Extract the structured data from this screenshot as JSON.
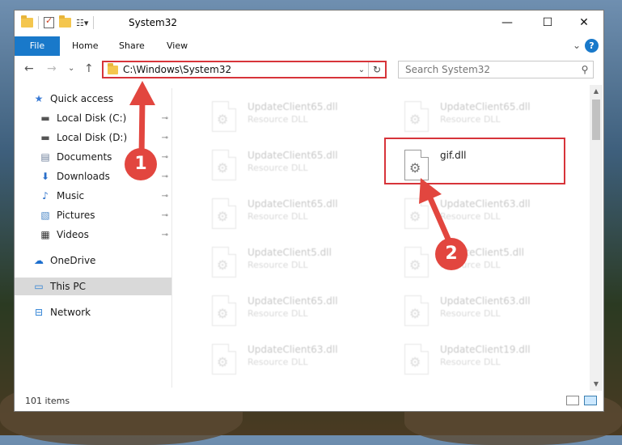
{
  "window": {
    "title": "System32",
    "controls": {
      "minimize": "—",
      "maximize": "☐",
      "close": "✕"
    }
  },
  "ribbon": {
    "tabs": [
      "File",
      "Home",
      "Share",
      "View"
    ],
    "collapse_glyph": "⌄",
    "help_label": "?"
  },
  "nav": {
    "back": "←",
    "forward": "→",
    "recent": "⌄",
    "up": "↑",
    "address": "C:\\Windows\\System32",
    "refresh": "↻",
    "search_placeholder": "Search System32"
  },
  "sidebar": {
    "items": [
      {
        "label": "Quick access",
        "icon": "star-icon",
        "glyph": "★",
        "color": "#3a7bd5",
        "pinned": false
      },
      {
        "label": "Local Disk (C:)",
        "icon": "drive-icon",
        "glyph": "▬",
        "color": "#555555",
        "pinned": true
      },
      {
        "label": "Local Disk (D:)",
        "icon": "drive-icon",
        "glyph": "▬",
        "color": "#555555",
        "pinned": true
      },
      {
        "label": "Documents",
        "icon": "documents-icon",
        "glyph": "▤",
        "color": "#6b7d99",
        "pinned": true
      },
      {
        "label": "Downloads",
        "icon": "downloads-icon",
        "glyph": "⬇",
        "color": "#2a6fc9",
        "pinned": true
      },
      {
        "label": "Music",
        "icon": "music-icon",
        "glyph": "♪",
        "color": "#2a6fc9",
        "pinned": true
      },
      {
        "label": "Pictures",
        "icon": "pictures-icon",
        "glyph": "▧",
        "color": "#4a86c5",
        "pinned": true
      },
      {
        "label": "Videos",
        "icon": "videos-icon",
        "glyph": "▦",
        "color": "#333333",
        "pinned": true
      },
      {
        "label": "OneDrive",
        "icon": "onedrive-icon",
        "glyph": "☁",
        "color": "#1d6fce",
        "pinned": false
      },
      {
        "label": "This PC",
        "icon": "computer-icon",
        "glyph": "▭",
        "color": "#2a7fd4",
        "pinned": false
      },
      {
        "label": "Network",
        "icon": "network-icon",
        "glyph": "⊟",
        "color": "#2a7fd4",
        "pinned": false
      }
    ],
    "pin_glyph": "📌"
  },
  "files": [
    {
      "name": "UpdateClient65.dll",
      "type": "Resource DLL"
    },
    {
      "name": "UpdateClient65.dll",
      "type": "Resource DLL"
    },
    {
      "name": "UpdateClient65.dll",
      "type": "Resource DLL"
    },
    {
      "name": "gif.dll",
      "type": ""
    },
    {
      "name": "UpdateClient65.dll",
      "type": "Resource DLL"
    },
    {
      "name": "UpdateClient63.dll",
      "type": "Resource DLL"
    },
    {
      "name": "UpdateClient5.dll",
      "type": "Resource DLL"
    },
    {
      "name": "UpdateClient5.dll",
      "type": "Resource DLL"
    },
    {
      "name": "UpdateClient65.dll",
      "type": "Resource DLL"
    },
    {
      "name": "UpdateClient63.dll",
      "type": "Resource DLL"
    },
    {
      "name": "UpdateClient63.dll",
      "type": "Resource DLL"
    },
    {
      "name": "UpdateClient19.dll",
      "type": "Resource DLL"
    }
  ],
  "status": {
    "item_count": "101 items"
  },
  "callouts": [
    "1",
    "2"
  ],
  "colors": {
    "accent": "#1979ca",
    "highlight": "#d7343a",
    "callout": "#e2463f"
  }
}
